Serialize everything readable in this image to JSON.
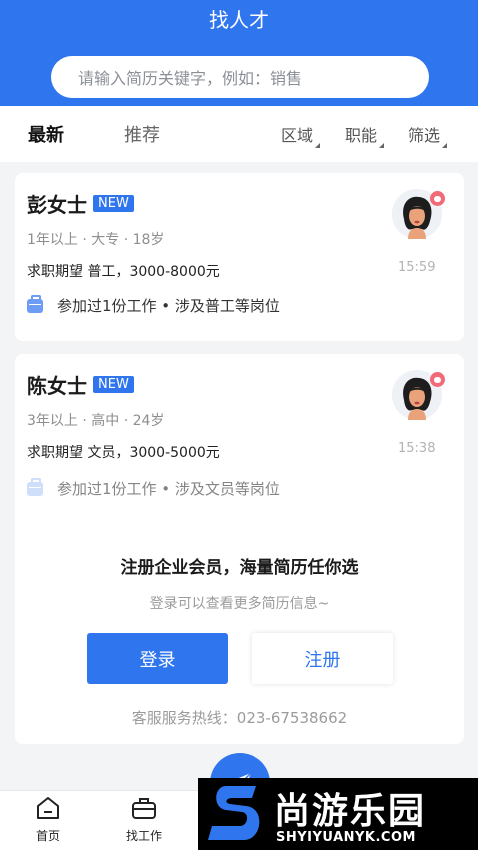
{
  "header": {
    "title": "找人才",
    "search_placeholder": "请输入简历关键字，例如：销售"
  },
  "tabs": {
    "active": "最新",
    "inactive": "推荐"
  },
  "filters": [
    "区域",
    "职能",
    "筛选"
  ],
  "candidates": [
    {
      "name": "彭女士",
      "badge": "NEW",
      "meta": "1年以上 · 大专 · 18岁",
      "expectation": "求职期望 普工，3000-8000元",
      "experience": "参加过1份工作 • 涉及普工等岗位",
      "time": "15:59"
    },
    {
      "name": "陈女士",
      "badge": "NEW",
      "meta": "3年以上 · 高中 · 24岁",
      "expectation": "求职期望 文员，3000-5000元",
      "experience": "参加过1份工作 • 涉及文员等岗位",
      "time": "15:38"
    }
  ],
  "promo": {
    "title": "注册企业会员，海量简历任你选",
    "subtitle": "登录可以查看更多简历信息~",
    "login_label": "登录",
    "register_label": "注册",
    "hotline": "客服服务热线：023-67538662"
  },
  "bottom_nav": [
    {
      "label": "首页",
      "icon": "home-icon"
    },
    {
      "label": "找工作",
      "icon": "briefcase-icon"
    }
  ],
  "watermark": {
    "brand": "尚游乐园",
    "url": "SHYIYUANYK.COM"
  },
  "colors": {
    "primary": "#2f76ee",
    "badge_dot": "#f06a78"
  }
}
